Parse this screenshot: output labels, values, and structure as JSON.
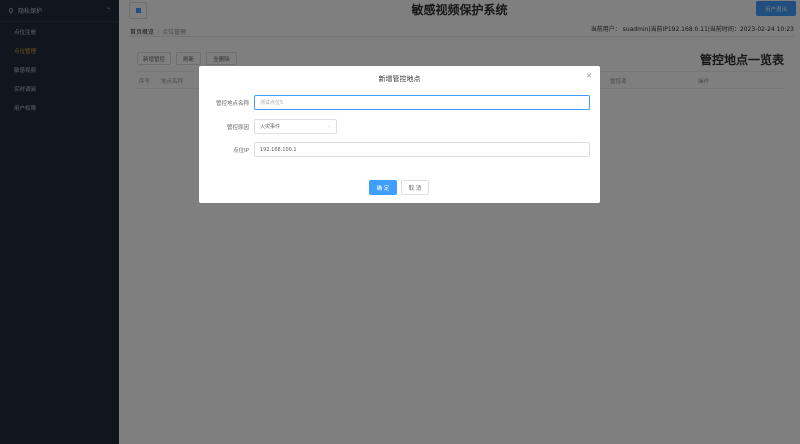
{
  "app": {
    "title": "敏感视频保护系统",
    "logout_label": "用户退出",
    "user_info": "当前用户： suadmin|当前IP192.168.0.11|当前时间：2023-02-24 10:23"
  },
  "sidebar": {
    "header": "隐私保护",
    "items": [
      {
        "label": "点位注册"
      },
      {
        "label": "点位管理"
      },
      {
        "label": "敏感视频"
      },
      {
        "label": "实时调阅"
      },
      {
        "label": "用户权限"
      }
    ]
  },
  "breadcrumb": {
    "home": "首页概览",
    "separator": "/",
    "current": "点位管理"
  },
  "toolbar": {
    "add_label": "新增管控",
    "refresh_label": "刷新",
    "delete_all_label": "全删除"
  },
  "table": {
    "title": "管控地点一览表",
    "columns": [
      "序号",
      "地点名称",
      "管控源",
      "操作"
    ]
  },
  "dialog": {
    "title": "新增管控地点",
    "close_icon": "close-icon",
    "fields": {
      "name_label": "管控地点名称",
      "name_placeholder": "测试点位5",
      "reason_label": "管控原因",
      "reason_value": "火灾事件",
      "ip_label": "点位IP",
      "ip_value": "192.168.100.1"
    },
    "confirm_label": "确 定",
    "cancel_label": "取 消"
  },
  "colors": {
    "primary": "#409eff",
    "sidebar_bg": "#1f2d3d",
    "active_menu": "#e6a23c"
  }
}
